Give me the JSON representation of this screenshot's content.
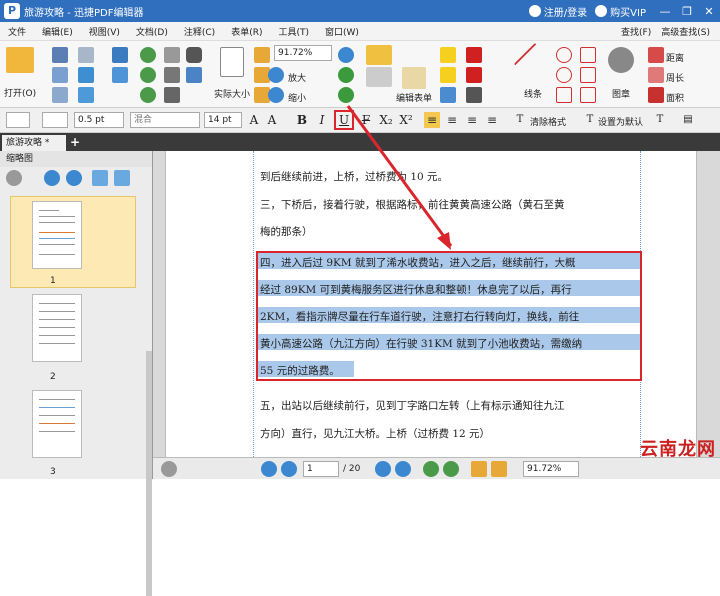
{
  "app": {
    "title": "旅游攻略 - 迅捷PDF编辑器",
    "login": "注册/登录",
    "buy": "购买VIP"
  },
  "menu": [
    "文件",
    "编辑(E)",
    "视图(V)",
    "文档(D)",
    "注释(C)",
    "表单(R)",
    "工具(T)",
    "窗口(W)"
  ],
  "menu_right": [
    "查找(F)",
    "高级查找(S)"
  ],
  "ribbon": {
    "open": "打开(O)",
    "zoom": "91.72%",
    "actual": "实际大小",
    "zoom_in": "放大",
    "zoom_out": "缩小",
    "edit_form": "编辑表单",
    "lines": "线条",
    "stamp": "图章",
    "distance": "距离",
    "perimeter": "周长",
    "area": "面积"
  },
  "fmt": {
    "line": "0.5 pt",
    "blend": "混合",
    "size": "14 pt",
    "clear": "清除格式",
    "default": "设置为默认"
  },
  "tab": {
    "label": "旅游攻略 *",
    "plus": "+"
  },
  "sidebar": {
    "header": "缩略图",
    "pages": [
      "1",
      "2",
      "3"
    ]
  },
  "doc_lines": [
    "到后继续前进，上桥，过桥费为 10 元。",
    "三，下桥后，接着行驶，根据路标，前往黄黄高速公路（黄石至黄",
    "梅的那条）",
    "四，进入后过 9KM 就到了浠水收费站，进入之后，继续前行，大概",
    "经过 89KM 可到黄梅服务区进行休息和整顿！休息完了以后，再行",
    "2KM，看指示牌尽量在行车道行驶，注意打右行转向灯，换线，前往",
    "黄小高速公路（九江方向）在行驶 31KM 就到了小池收费站，需缴纳",
    "55 元的过路费。",
    "五，出站以后继续前行，见到丁字路口左转（上有标示通知往九江",
    "方向）直行，见九江大桥。上桥（过桥费 12 元）"
  ],
  "bottom": {
    "page": "1",
    "total": "/ 20",
    "zoom": "91.72%"
  },
  "watermark": "云南龙网",
  "colors": {
    "title_bar": "#2f6fbe",
    "highlight": "#a9c8ea",
    "annotation_red": "#d9262c"
  }
}
